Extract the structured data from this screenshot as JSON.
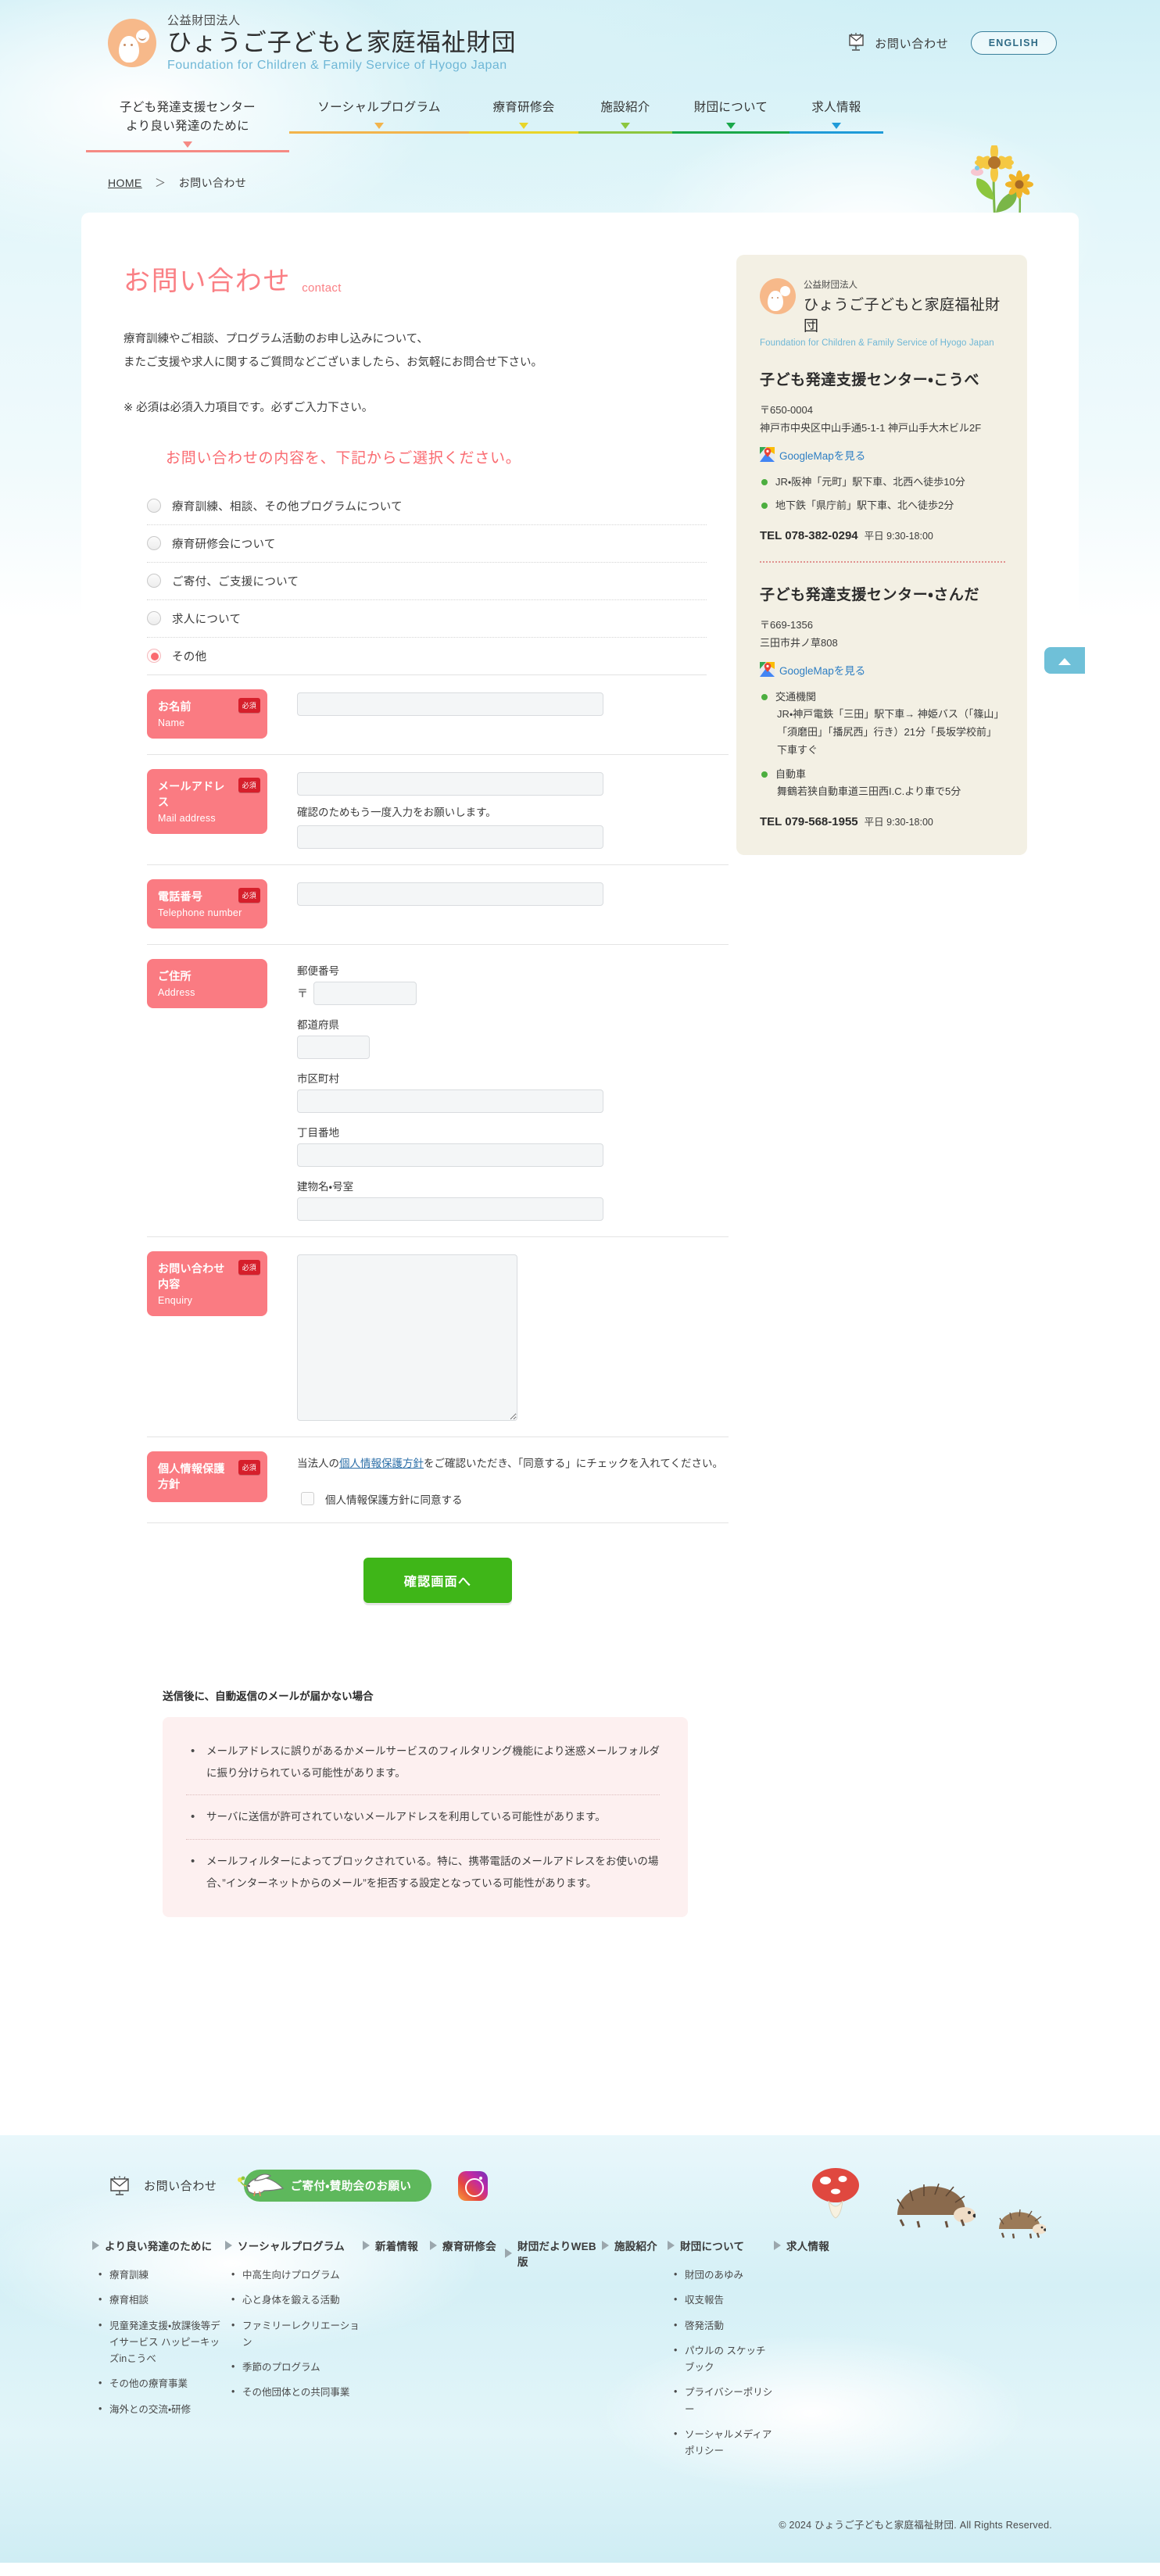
{
  "brand": {
    "kicker": "公益財団法人",
    "name": "ひょうご子どもと家庭福祉財団",
    "english": "Foundation for Children & Family Service of Hyogo Japan"
  },
  "header": {
    "contact_label": "お問い合わせ",
    "english_button": "ENGLISH"
  },
  "nav": {
    "items": [
      {
        "line1": "子ども発達支援センター",
        "line2": "より良い発達のために",
        "color": "#f58a84"
      },
      {
        "line1": "ソーシャルプログラム",
        "line2": "",
        "color": "#f2b44c"
      },
      {
        "line1": "療育研修会",
        "line2": "",
        "color": "#e8d52a"
      },
      {
        "line1": "施設紹介",
        "line2": "",
        "color": "#8cc63e"
      },
      {
        "line1": "財団について",
        "line2": "",
        "color": "#1aa84a"
      },
      {
        "line1": "求人情報",
        "line2": "",
        "color": "#1f9bd8"
      }
    ]
  },
  "breadcrumb": {
    "home": "HOME",
    "separator": "＞",
    "current": "お問い合わせ"
  },
  "page": {
    "title": "お問い合わせ",
    "title_en": "contact",
    "intro_line1": "療育訓練やご相談、プログラム活動のお申し込みについて、",
    "intro_line2": "またご支援や求人に関するご質問などございましたら、お気軽にお問合せ下さい。",
    "required_note": "※ 必須は必須入力項目です。必ずご入力下さい。",
    "select_lead": "お問い合わせの内容を、下記からご選択ください。"
  },
  "inquiry_options": [
    {
      "label": "療育訓練、相談、その他プログラムについて",
      "selected": false
    },
    {
      "label": "療育研修会について",
      "selected": false
    },
    {
      "label": "ご寄付、ご支援について",
      "selected": false
    },
    {
      "label": "求人について",
      "selected": false
    },
    {
      "label": "その他",
      "selected": true
    }
  ],
  "form": {
    "required_badge": "必須",
    "name": {
      "ja": "お名前",
      "en": "Name",
      "value": "",
      "placeholder": ""
    },
    "mail": {
      "ja": "メールアドレス",
      "en": "Mail address",
      "value": "",
      "placeholder": "",
      "confirm_hint": "確認のためもう一度入力をお願いします。",
      "confirm_value": "",
      "confirm_placeholder": ""
    },
    "tel": {
      "ja": "電話番号",
      "en": "Telephone number",
      "value": "",
      "placeholder": ""
    },
    "address": {
      "ja": "ご住所",
      "en": "Address",
      "zip_label": "郵便番号",
      "zip_mark": "〒",
      "zip_value": "",
      "pref_label": "都道府県",
      "pref_value": "",
      "city_label": "市区町村",
      "city_value": "",
      "block_label": "丁目番地",
      "block_value": "",
      "building_label": "建物名・号室",
      "building_value": ""
    },
    "enquiry": {
      "ja": "お問い合わせ内容",
      "en": "Enquiry",
      "value": "",
      "placeholder": ""
    },
    "privacy": {
      "ja": "個人情報保護方針",
      "text_before": "当法人の",
      "link": "個人情報保護方針",
      "text_after": "をご確認いただき、「同意する」にチェックを入れてください。",
      "checkbox_label": "個人情報保護方針に同意する",
      "checked": false
    },
    "submit_label": "確認画面へ"
  },
  "failure_notice": {
    "title": "送信後に、自動返信のメールが届かない場合",
    "items": [
      "メールアドレスに誤りがあるかメールサービスのフィルタリング機能により迷惑メールフォルダに振り分けられている可能性があります。",
      "サーバに送信が許可されていないメールアドレスを利用している可能性があります。",
      "メールフィルターによってブロックされている。特に、携帯電話のメールアドレスをお使いの場合、”インターネットからのメール”を拒否する設定となっている可能性があります。"
    ]
  },
  "side_panel": {
    "gmap_label": "GoogleMapを見る",
    "centers": [
      {
        "name": "子ども発達支援センター・こうべ",
        "zip": "〒650-0004",
        "address": "神戸市中央区中山手通5-1-1 神戸山手大木ビル2F",
        "access": [
          {
            "main": "JR・阪神「元町」駅下車、北西へ徒歩10分",
            "sub": ""
          },
          {
            "main": "地下鉄「県庁前」駅下車、北へ徒歩2分",
            "sub": ""
          }
        ],
        "tel_label": "TEL",
        "tel": "078-382-0294",
        "hours": "平日 9:30-18:00"
      },
      {
        "name": "子ども発達支援センター・さんだ",
        "zip": "〒669-1356",
        "address": "三田市井ノ草808",
        "access": [
          {
            "main": "交通機関",
            "sub": "JR・神戸電鉄「三田」駅下車→ 神姫バス（「篠山」「須磨田」「播尻西」行き）21分「長坂学校前」下車すぐ"
          },
          {
            "main": "自動車",
            "sub": "舞鶴若狭自動車道三田西I.C.より車で5分"
          }
        ],
        "tel_label": "TEL",
        "tel": "079-568-1955",
        "hours": "平日 9:30-18:00"
      }
    ]
  },
  "footer": {
    "contact_label": "お問い合わせ",
    "donate_label": "ご寄付・賛助会のお願い",
    "columns": [
      {
        "head": "より良い発達のために",
        "items": [
          "療育訓練",
          "療育相談",
          "児童発達支援・放課後等デイサービス ハッピーキッズinこうべ",
          "その他の療育事業",
          "海外との交流・研修"
        ]
      },
      {
        "head": "ソーシャルプログラム",
        "items": [
          "中高生向けプログラム",
          "心と身体を鍛える活動",
          "ファミリーレクリエーション",
          "季節のプログラム",
          "その他団体との共同事業"
        ]
      },
      {
        "head": "新着情報",
        "items": []
      },
      {
        "head": "療育研修会",
        "items": []
      },
      {
        "head": "財団だよりWEB版",
        "items": []
      },
      {
        "head": "施設紹介",
        "items": []
      },
      {
        "head": "財団について",
        "items": [
          "財団のあゆみ",
          "収支報告",
          "啓発活動",
          "パウルの スケッチブック",
          "プライバシーポリシー",
          "ソーシャルメディアポリシー"
        ]
      },
      {
        "head": "求人情報",
        "items": []
      }
    ],
    "copyright": "© 2024 ひょうご子どもと家庭福祉財団. All Rights Reserved."
  },
  "colors": {
    "accent_pink": "#fa7f84",
    "required_red": "#d61f2b",
    "submit_green": "#3fb618",
    "link_blue": "#2f7fc4",
    "panel_beige": "#f3f0e4",
    "notice_pink": "#fdf0f0"
  }
}
